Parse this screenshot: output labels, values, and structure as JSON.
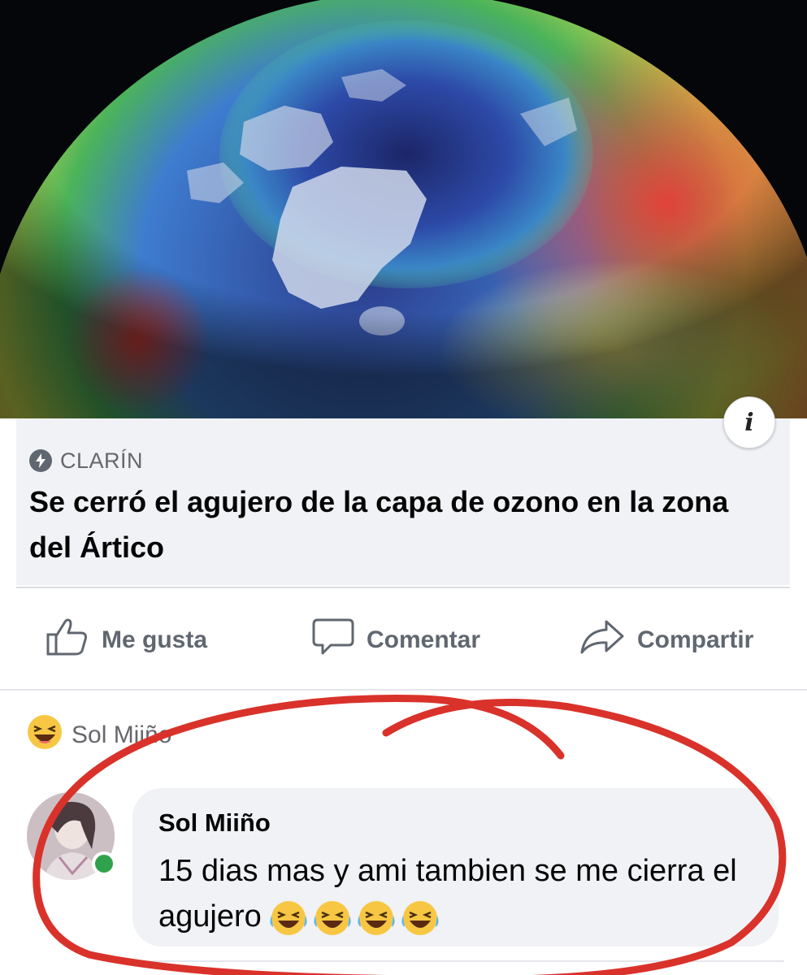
{
  "post": {
    "link_preview": {
      "image": "arctic-ozone-map",
      "info_label": "i",
      "source_icon": "bolt-icon",
      "source": "CLARÍN",
      "headline": "Se cerró el agujero de la capa de ozono en la zona del Ártico"
    },
    "actions": [
      {
        "icon": "thumbs-up-icon",
        "label": "Me gusta"
      },
      {
        "icon": "comment-icon",
        "label": "Comentar"
      },
      {
        "icon": "share-icon",
        "label": "Compartir"
      }
    ]
  },
  "reaction_row": {
    "emoji": "laughing-emoji-icon",
    "name": "Sol Miiño"
  },
  "comment": {
    "author": "Sol Miiño",
    "avatar": "avatar-photo",
    "online": true,
    "text": "15 dias mas y ami tambien se me cierra el agujero",
    "emojis": [
      "laughing-emoji-icon",
      "laughing-emoji-icon",
      "laughing-emoji-icon",
      "laughing-emoji-icon"
    ]
  },
  "colors": {
    "link_box_bg": "#f0f2f5",
    "action_text": "#606770",
    "online_green": "#31a24c",
    "annotation_red": "#d9322b"
  }
}
